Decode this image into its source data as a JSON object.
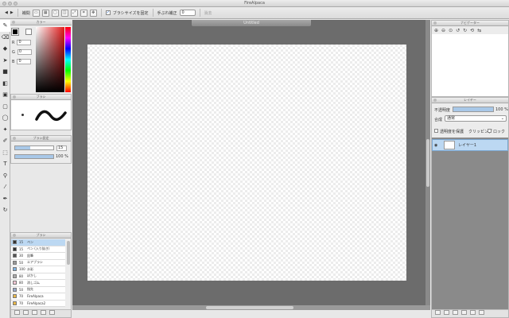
{
  "window": {
    "title": "FireAlpaca"
  },
  "toolbar": {
    "undo_icon": "undo-icon",
    "redo_icon": "redo-icon",
    "antialias_label": "補間",
    "snap_label": "ブラシサイズを固定",
    "correction_label": "手ぶれ補正",
    "correction_value": "0",
    "reset_label": "消去"
  },
  "tools": [
    "pen",
    "eraser",
    "fill",
    "select-move",
    "bucket",
    "gradient",
    "shape",
    "lasso",
    "magic-wand",
    "eyedropper",
    "text",
    "zoom",
    "hand",
    "dot-pen",
    "rotate"
  ],
  "color_panel": {
    "title": "カラー",
    "r_label": "R",
    "r_value": "0",
    "g_label": "G",
    "g_value": "0",
    "b_label": "B",
    "b_value": "0",
    "primary_color": "#000000"
  },
  "brush_preview": {
    "title": "ブラシ"
  },
  "brush_control": {
    "title": "ブラシ設定",
    "size_value": "15",
    "opacity_value": "100 %",
    "opacity_fraction": 1.0
  },
  "brush_list": {
    "title": "ブラシ",
    "items": [
      {
        "size": "15",
        "name": "ペン"
      },
      {
        "size": "15",
        "name": "ペン (入り抜き)"
      },
      {
        "size": "30",
        "name": "鉛筆"
      },
      {
        "size": "50",
        "name": "エアブラシ"
      },
      {
        "size": "100",
        "name": "水彩"
      },
      {
        "size": "80",
        "name": "ぼかし"
      },
      {
        "size": "80",
        "name": "消しゴム"
      },
      {
        "size": "50",
        "name": "指先"
      },
      {
        "size": "70",
        "name": "FireAlpaca"
      },
      {
        "size": "70",
        "name": "FireAlpaca2"
      }
    ],
    "selected_index": 0
  },
  "canvas": {
    "document_title": "Untitled"
  },
  "navigator": {
    "title": "ナビゲーター"
  },
  "layer_panel": {
    "title": "レイヤー",
    "opacity_label": "不透明度",
    "opacity_value": "100 %",
    "opacity_fraction": 1.0,
    "blend_label": "合成",
    "blend_value": "通常",
    "protect_label": "透明度を保護",
    "clip_label": "クリッピング",
    "lock_label": "ロック",
    "layers": [
      {
        "name": "レイヤー1"
      }
    ]
  },
  "colors": {
    "accent": "#2b6fd6",
    "selection": "#bcd8f2",
    "canvas_bg": "#6c6c6c"
  }
}
